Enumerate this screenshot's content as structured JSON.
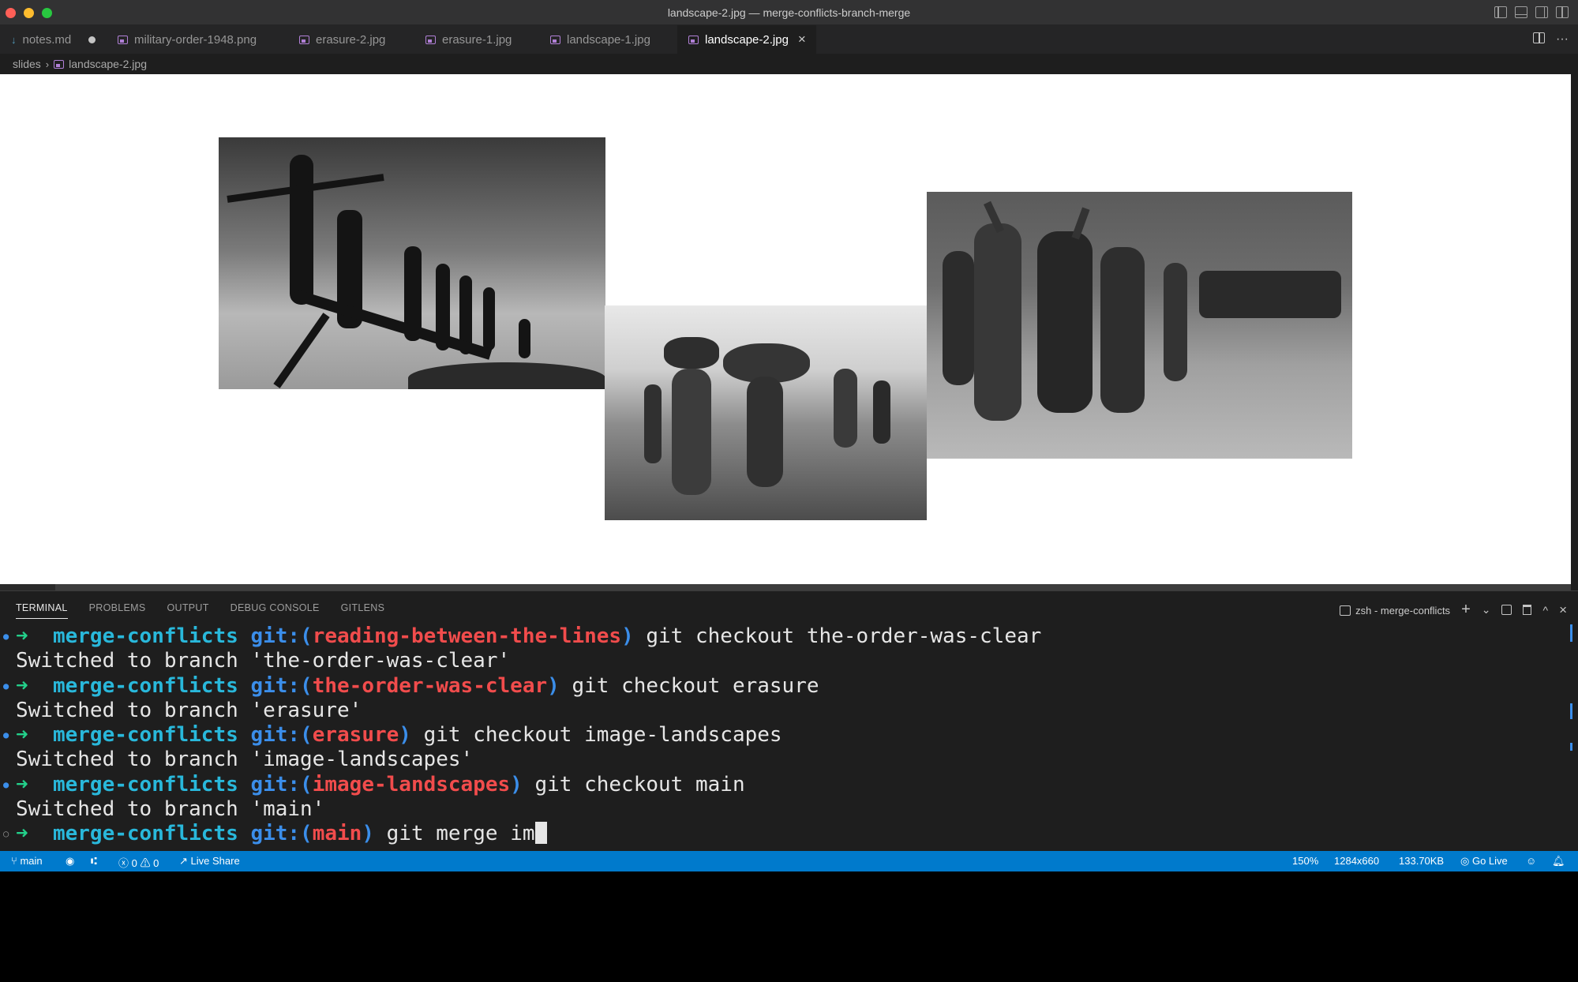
{
  "window": {
    "title": "landscape-2.jpg — merge-conflicts-branch-merge"
  },
  "tabs": [
    {
      "label": "notes.md",
      "dirty": true,
      "type": "markdown"
    },
    {
      "label": "military-order-1948.png",
      "type": "image"
    },
    {
      "label": "erasure-2.jpg",
      "type": "image"
    },
    {
      "label": "erasure-1.jpg",
      "type": "image"
    },
    {
      "label": "landscape-1.jpg",
      "type": "image"
    },
    {
      "label": "landscape-2.jpg",
      "type": "image",
      "active": true
    }
  ],
  "tab_close_glyph": "×",
  "tab_more_glyph": "···",
  "breadcrumb": {
    "folder": "slides",
    "separator": "›",
    "file": "landscape-2.jpg"
  },
  "panel": {
    "tabs": [
      "TERMINAL",
      "PROBLEMS",
      "OUTPUT",
      "DEBUG CONSOLE",
      "GITLENS"
    ],
    "active_tab": "TERMINAL",
    "terminal_name": "zsh - merge-conflicts",
    "add_glyph": "+",
    "dropdown_glyph": "⌄",
    "maximize_glyph": "^",
    "close_glyph": "×"
  },
  "terminal": {
    "lines": [
      {
        "kind": "prompt",
        "arrow": "➜",
        "dir": "merge-conflicts",
        "git_label": "git:(",
        "branch": "reading-between-the-lines",
        "git_close": ")",
        "command": "git checkout the-order-was-clear"
      },
      {
        "kind": "output",
        "text": "Switched to branch 'the-order-was-clear'"
      },
      {
        "kind": "prompt",
        "arrow": "➜",
        "dir": "merge-conflicts",
        "git_label": "git:(",
        "branch": "the-order-was-clear",
        "git_close": ")",
        "command": "git checkout erasure"
      },
      {
        "kind": "output",
        "text": "Switched to branch 'erasure'"
      },
      {
        "kind": "prompt",
        "arrow": "➜",
        "dir": "merge-conflicts",
        "git_label": "git:(",
        "branch": "erasure",
        "git_close": ")",
        "command": "git checkout image-landscapes"
      },
      {
        "kind": "output",
        "text": "Switched to branch 'image-landscapes'"
      },
      {
        "kind": "prompt",
        "arrow": "➜",
        "dir": "merge-conflicts",
        "git_label": "git:(",
        "branch": "image-landscapes",
        "git_close": ")",
        "command": "git checkout main"
      },
      {
        "kind": "output",
        "text": "Switched to branch 'main'"
      },
      {
        "kind": "prompt",
        "arrow": "➜",
        "dir": "merge-conflicts",
        "git_label": "git:(",
        "branch": "main",
        "git_close": ")",
        "command": "git merge im"
      }
    ]
  },
  "statusbar": {
    "branch": "main",
    "errors": "0",
    "warnings": "0",
    "live_share": "Live Share",
    "zoom": "150%",
    "dimensions": "1284x660",
    "file_size": "133.70KB",
    "go_live": "Go Live"
  },
  "colors": {
    "accent": "#007acc",
    "terminal_arrow": "#23d18b",
    "terminal_dir": "#29b8db",
    "terminal_branch": "#f14c4c"
  }
}
